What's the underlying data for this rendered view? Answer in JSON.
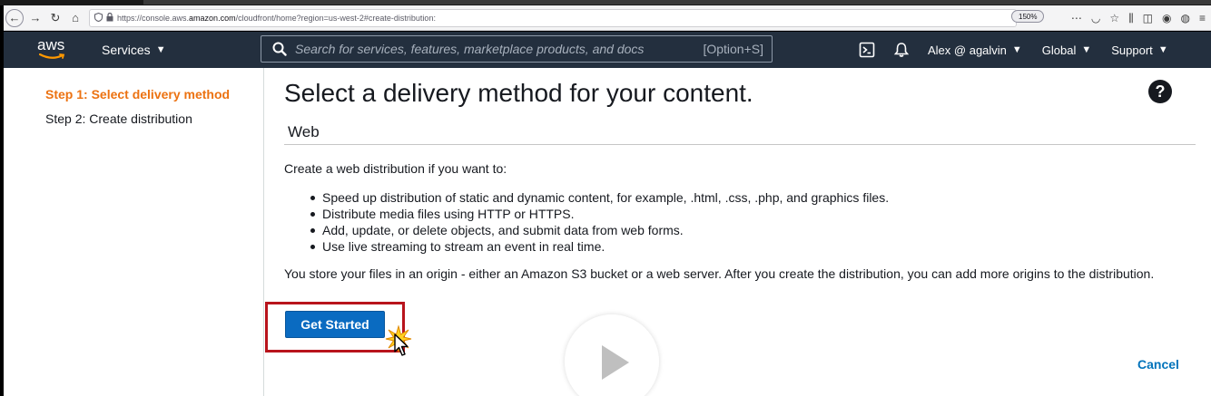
{
  "browser": {
    "url_prefix": "https://console.aws.",
    "url_host": "amazon.com",
    "url_path": "/cloudfront/home?region=us-west-2#create-distribution:",
    "zoom": "150%"
  },
  "awsnav": {
    "logo": "aws",
    "services_label": "Services",
    "search_placeholder": "Search for services, features, marketplace products, and docs",
    "search_shortcut": "[Option+S]",
    "user_label": "Alex @ agalvin",
    "region_label": "Global",
    "support_label": "Support"
  },
  "sidebar": {
    "step1": "Step 1: Select delivery method",
    "step2": "Step 2: Create distribution"
  },
  "main": {
    "title": "Select a delivery method for your content.",
    "section": "Web",
    "intro": "Create a web distribution if you want to:",
    "bullets": [
      "Speed up distribution of static and dynamic content, for example, .html, .css, .php, and graphics files.",
      "Distribute media files using HTTP or HTTPS.",
      "Add, update, or delete objects, and submit data from web forms.",
      "Use live streaming to stream an event in real time."
    ],
    "store_text": "You store your files in an origin - either an Amazon S3 bucket or a web server. After you create the distribution, you can add more origins to the distribution.",
    "get_started_label": "Get Started",
    "cancel_label": "Cancel"
  },
  "colors": {
    "aws_nav": "#232f3e",
    "step_active": "#ec7211",
    "primary_button": "#0a6bc1",
    "highlight_box": "#b8141c",
    "link": "#0073bb"
  },
  "icons": [
    "back-icon",
    "forward-icon",
    "reload-icon",
    "home-icon",
    "shield-icon",
    "lock-icon",
    "search-icon",
    "cloudshell-icon",
    "bell-icon",
    "help-icon",
    "play-icon",
    "cursor-icon"
  ]
}
